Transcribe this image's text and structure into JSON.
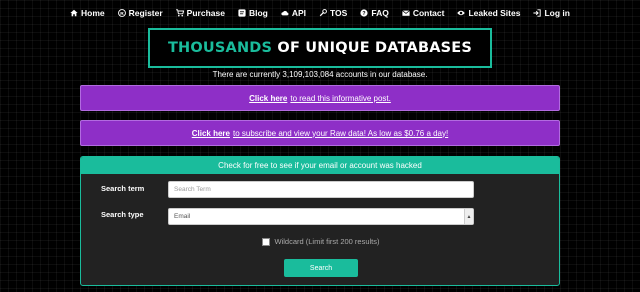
{
  "nav": {
    "items": [
      {
        "label": "Home",
        "icon": "home-icon"
      },
      {
        "label": "Register",
        "icon": "register-icon"
      },
      {
        "label": "Purchase",
        "icon": "cart-icon"
      },
      {
        "label": "Blog",
        "icon": "blog-icon"
      },
      {
        "label": "API",
        "icon": "cloud-icon"
      },
      {
        "label": "TOS",
        "icon": "wrench-icon"
      },
      {
        "label": "FAQ",
        "icon": "question-icon"
      },
      {
        "label": "Contact",
        "icon": "envelope-icon"
      },
      {
        "label": "Leaked Sites",
        "icon": "eye-icon"
      },
      {
        "label": "Log in",
        "icon": "login-icon"
      }
    ]
  },
  "banner": {
    "accent": "THOUSANDS",
    "rest": "OF UNIQUE DATABASES"
  },
  "count": {
    "prefix": "There are currently",
    "value": "3,109,103,084",
    "suffix": "accounts in our database."
  },
  "notices": {
    "informative": {
      "link": "Click here",
      "text": "to read this informative post."
    },
    "subscribe": {
      "link": "Click here",
      "text": "to subscribe and view your Raw data! As low as $0.76 a day!"
    }
  },
  "search_panel": {
    "header": "Check for free to see if your email or account was hacked",
    "term_label": "Search term",
    "term_placeholder": "Search Term",
    "type_label": "Search type",
    "type_value": "Email",
    "wildcard_label": "Wildcard (Limit first 200 results)",
    "button_label": "Search"
  },
  "colors": {
    "accent": "#1abc9c",
    "purple": "#8e2fc7",
    "background": "#000000",
    "panel": "#222222"
  }
}
